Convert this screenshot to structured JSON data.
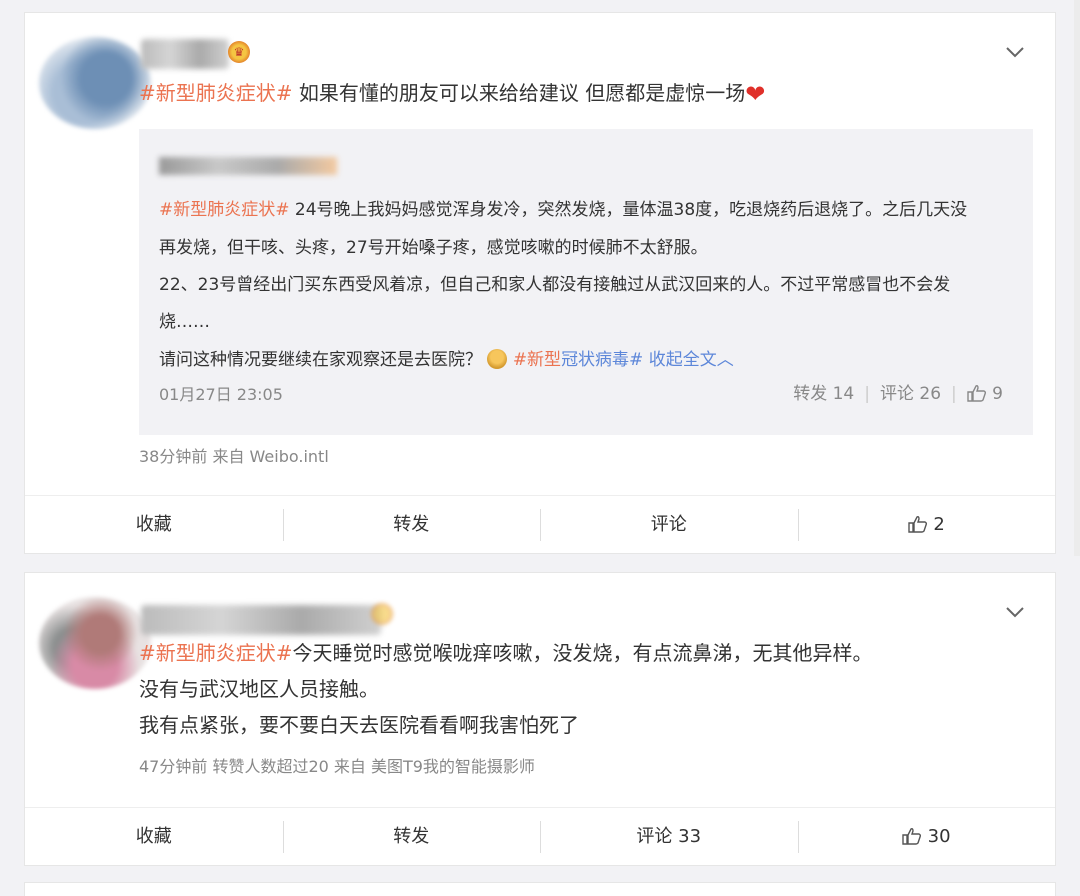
{
  "posts": [
    {
      "hashtag": "#新型肺炎症状#",
      "text": " 如果有懂的朋友可以来给给建议 但愿都是虚惊一场",
      "heart": "❤",
      "repost": {
        "hashtag": "#新型肺炎症状#",
        "line1": " 24号晚上我妈妈感觉浑身发冷，突然发烧，量体温38度，吃退烧药后退烧了。之后几天没",
        "line2": "再发烧，但干咳、头疼，27号开始嗓子疼，感觉咳嗽的时候肺不太舒服。",
        "line3": "22、23号曾经出门买东西受风着凉，但自己和家人都没有接触过从武汉回来的人。不过平常感冒也不会发",
        "line4": "烧……",
        "line5": "请问这种情况要继续在家观察还是去医院？",
        "tag2a": "#新型",
        "tag2b": "冠状病毒#",
        "collapse": "收起全文",
        "time": "01月27日 23:05",
        "repost_count": "转发 14",
        "comment_count": "评论 26",
        "like_count": "9"
      },
      "meta": "38分钟前  来自 Weibo.intl",
      "actions": {
        "favorite": "收藏",
        "repost": "转发",
        "comment": "评论",
        "likes": "2"
      }
    },
    {
      "hashtag": "#新型肺炎症状#",
      "line1": "今天睡觉时感觉喉咙痒咳嗽，没发烧，有点流鼻涕，无其他异样。",
      "line2": "没有与武汉地区人员接触。",
      "line3": "我有点紧张，要不要白天去医院看看啊我害怕死了",
      "meta": "47分钟前 转赞人数超过20  来自 美图T9我的智能摄影师",
      "actions": {
        "favorite": "收藏",
        "repost": "转发",
        "comment": "评论 33",
        "likes": "30"
      }
    }
  ]
}
